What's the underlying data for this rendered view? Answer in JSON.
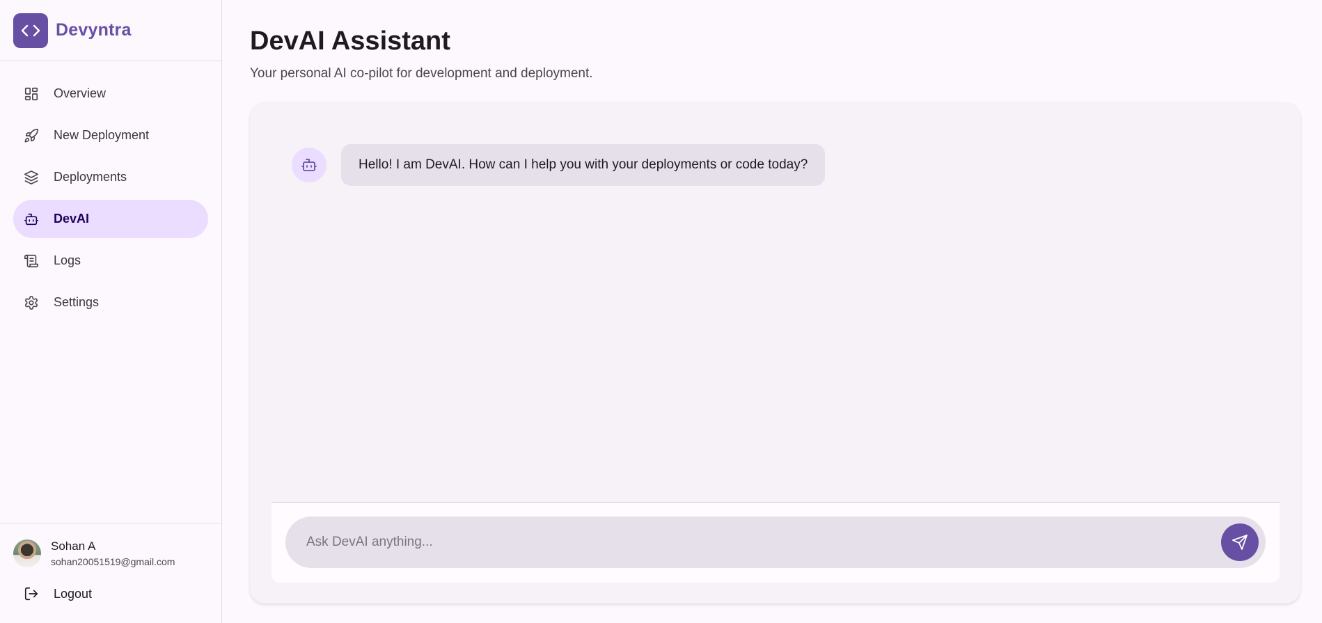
{
  "brand": {
    "name": "Devyntra",
    "logo_icon": "code-brackets-icon",
    "accent": "#6750a4"
  },
  "nav": {
    "items": [
      {
        "label": "Overview",
        "icon": "dashboard-grid-icon"
      },
      {
        "label": "New Deployment",
        "icon": "rocket-icon"
      },
      {
        "label": "Deployments",
        "icon": "layers-icon"
      },
      {
        "label": "DevAI",
        "icon": "bot-icon",
        "active": true
      },
      {
        "label": "Logs",
        "icon": "scroll-icon"
      },
      {
        "label": "Settings",
        "icon": "gear-icon"
      }
    ]
  },
  "user": {
    "name": "Sohan A",
    "email": "sohan20051519@gmail.com"
  },
  "logout": {
    "label": "Logout",
    "icon": "logout-icon"
  },
  "page": {
    "title": "DevAI Assistant",
    "subtitle": "Your personal AI co-pilot for development and deployment."
  },
  "chat": {
    "messages": [
      {
        "sender": "bot",
        "text": "Hello! I am DevAI. How can I help you with your deployments or code today?"
      }
    ],
    "input": {
      "placeholder": "Ask DevAI anything...",
      "value": ""
    },
    "send_icon": "send-icon"
  }
}
